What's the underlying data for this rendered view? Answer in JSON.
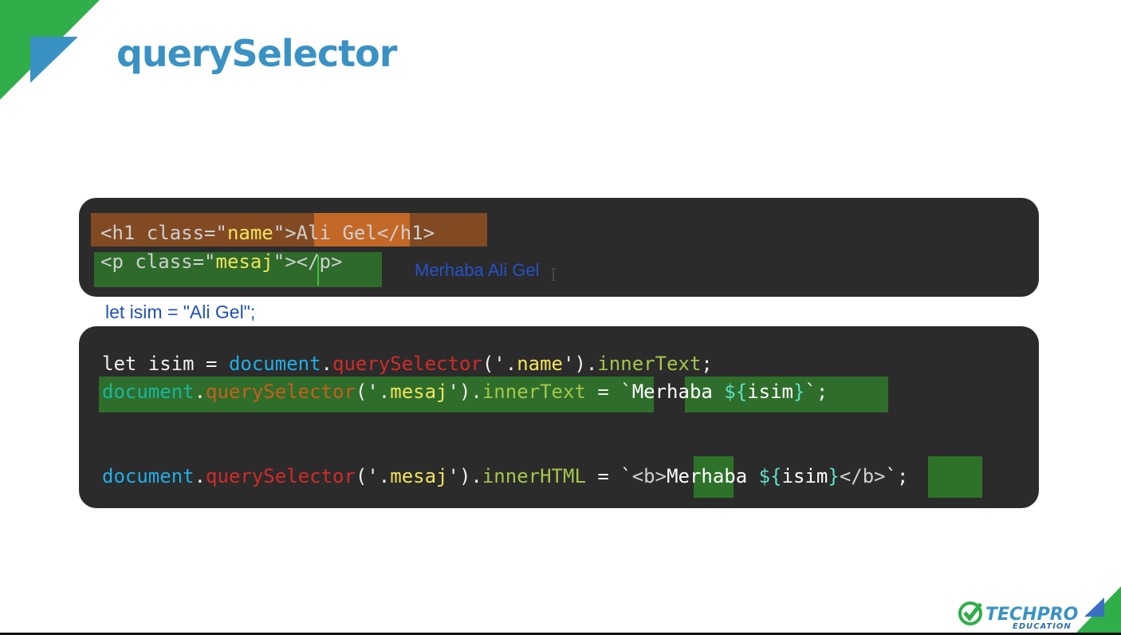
{
  "slide": {
    "title": "querySelector",
    "output_text": "Merhaba Ali Gel",
    "overlay_text": "let isim = \"Ali Gel\";"
  },
  "html_code": {
    "line1": {
      "open": "<h1 class=\"",
      "class_value": "name",
      "close_attr": "\">",
      "content": "Ali Gel",
      "end": "</h1>"
    },
    "line2": {
      "open": "<p class=\"",
      "class_value": "mesaj",
      "close_attr": "\">",
      "end": "</p>"
    }
  },
  "js_code": {
    "line1": {
      "kw": "let isim = ",
      "obj": "document",
      "dot": ".",
      "method": "querySelector",
      "arg_open": "('.",
      "arg": "name",
      "arg_close": "').",
      "prop": "innerText",
      "end": ";"
    },
    "line2": {
      "obj": "document",
      "dot": ".",
      "method": "querySelector",
      "arg_open": "('.",
      "arg": "mesaj",
      "arg_close": "').",
      "prop": "innerText",
      "assign": " = `",
      "tpl_text": "Merhaba ",
      "tpl_open": "${",
      "tpl_var": "isim",
      "tpl_close": "}",
      "end": "`;"
    },
    "line3": {
      "obj": "document",
      "dot": ".",
      "method": "querySelector",
      "arg_open": "('.",
      "arg": "mesaj",
      "arg_close": "').",
      "prop": "innerHTML",
      "assign": " = `",
      "b_open": "<b>",
      "tpl_text": "Merhaba ",
      "tpl_open": "${",
      "tpl_var": "isim",
      "tpl_close": "}",
      "b_close": "</b>",
      "end": "`;"
    }
  },
  "logo": {
    "brand": "TECHPRO",
    "sub": "EDUCATION"
  },
  "colors": {
    "title": "#3a92c4",
    "panel": "#2b2b2b",
    "highlight_orange": "#c8651e",
    "highlight_green": "#2f7a2a",
    "corner_green": "#2fae4a",
    "corner_blue": "#3a92c4"
  }
}
